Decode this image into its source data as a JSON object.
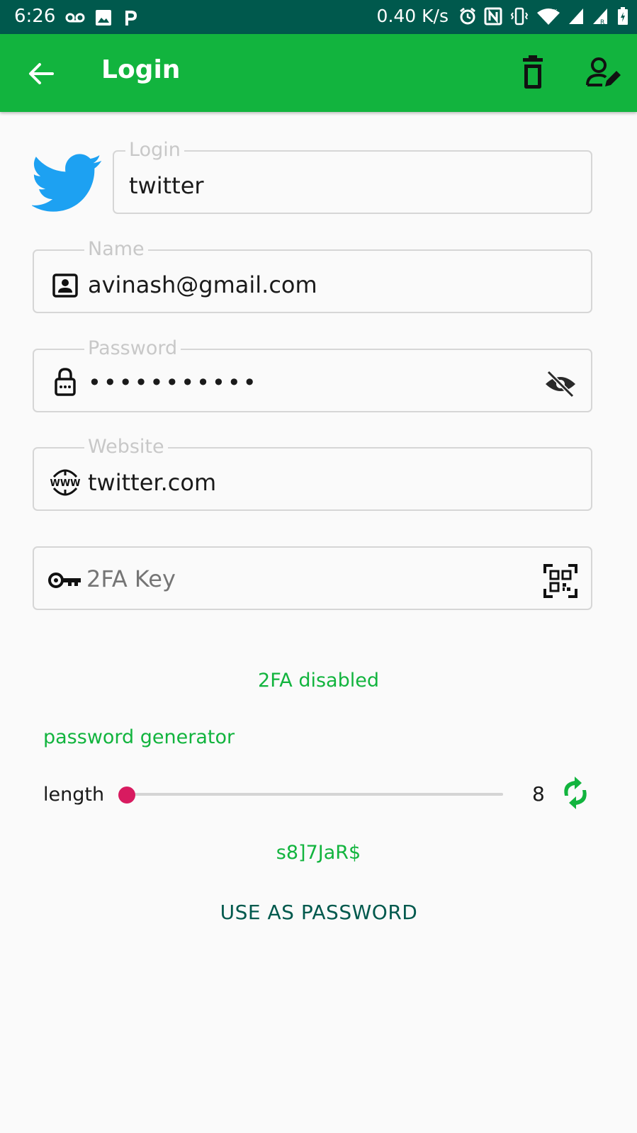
{
  "status_bar": {
    "time": "6:26",
    "speed": "0.40 K/s",
    "icons": [
      "voicemail-icon",
      "image-icon",
      "p-icon",
      "alarm-icon",
      "nfc-icon",
      "vibrate-icon",
      "wifi-icon",
      "signal-icon",
      "signal-r-icon",
      "battery-icon"
    ]
  },
  "app_bar": {
    "title": "Login",
    "background": "#12b43e"
  },
  "fields": {
    "login": {
      "legend": "Login",
      "value": "twitter"
    },
    "name": {
      "legend": "Name",
      "value": "avinash@gmail.com"
    },
    "password": {
      "legend": "Password",
      "value": "•••••••••••"
    },
    "website": {
      "legend": "Website",
      "value": "twitter.com"
    },
    "twofa": {
      "placeholder": "2FA Key",
      "value": ""
    }
  },
  "status_2fa": "2FA disabled",
  "generator": {
    "title": "password generator",
    "length_label": "length",
    "length_value": "8",
    "generated": "s8]7JaR$",
    "use_button": "USE AS PASSWORD"
  },
  "colors": {
    "accent": "#12b43e",
    "status_bar": "#00594d",
    "slider_thumb": "#d81b60",
    "twitter": "#1da1f2"
  }
}
